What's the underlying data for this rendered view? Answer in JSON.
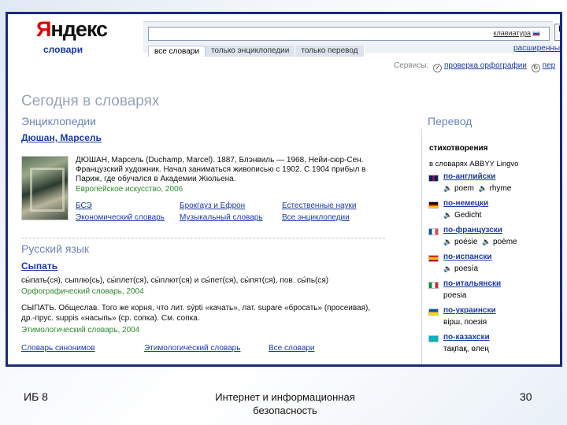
{
  "header": {
    "logo_first": "Я",
    "logo_rest": "ндекс",
    "logo_sub": "словари",
    "search_value": "",
    "keyboard_label": "клавиатура",
    "find_label": "Н",
    "scopes": [
      "все словари",
      "только энциклопедии",
      "только перевод"
    ],
    "advanced": "расширенный"
  },
  "services": {
    "label": "Сервисы:",
    "spellcheck": "проверка орфографии",
    "cut": "пер"
  },
  "today": "Сегодня в словарях",
  "encyclopedia": {
    "section": "Энциклопедии",
    "entry_title": "Дюшан, Марсель",
    "lines": [
      "ДЮШАН, Марсель (Duchamp, Marcel). 1887, Блэнвиль — 1968, Нейи-сюр-Сен.",
      "Французский художник. Начал заниматься живописью с 1902. С 1904 прибыл в",
      "Париж, где обучался в Академии Жюльена."
    ],
    "source": "Европейское искусство, 2006",
    "links_row1": [
      "БСЭ",
      "Брокгауз и Ефрон",
      "Естественные науки"
    ],
    "links_row2": [
      "Экономический словарь",
      "Музыкальный словарь",
      "Все энциклопедии"
    ]
  },
  "russian": {
    "section": "Русский язык",
    "entry_title": "Сыпать",
    "forms": "сы́пать(ся), сыплю(сь), сы́плет(ся), сы́плют(ся) и сы́пет(ся), сы́пят(ся), пов. сы́пь(ся)",
    "source1": "Орфографический словарь, 2004",
    "etym_lines": [
      "СЫПАТЬ. Общеслав. Того же корня, что лит. sýpti «качать», лат. supare «бросать» (просеивая),",
      "др.-прус. suppis «насыпь» (ср. сопка). См. сопка."
    ],
    "source2": "Этимологический словарь, 2004",
    "links": [
      "Словарь синонимов",
      "Этимологический словарь",
      "Все словари"
    ]
  },
  "translation": {
    "section": "Перевод",
    "word": "стихотворения",
    "via": "в словарях ABBYY Lingvo",
    "languages": [
      {
        "name": "по-английски",
        "tr": [
          "poem",
          "rhyme"
        ],
        "flag": "uk"
      },
      {
        "name": "по-немецки",
        "tr": [
          "Gedicht"
        ],
        "flag": "de"
      },
      {
        "name": "по-французски",
        "tr": [
          "poésie",
          "poème"
        ],
        "flag": "fr"
      },
      {
        "name": "по-испански",
        "tr": [
          "poesía"
        ],
        "flag": "es"
      },
      {
        "name": "по-итальянски",
        "tr": [
          "poesia"
        ],
        "flag": "it"
      },
      {
        "name": "по-украински",
        "tr": [
          "вірш, поезія"
        ],
        "flag": "ua"
      },
      {
        "name": "по-казахски",
        "tr": [
          "тақпақ, өлең"
        ],
        "flag": "kz"
      }
    ]
  },
  "footer": {
    "left": "ИБ 8",
    "center_line1": "Интернет и информационная",
    "center_line2": "безопасность",
    "page": "30"
  }
}
